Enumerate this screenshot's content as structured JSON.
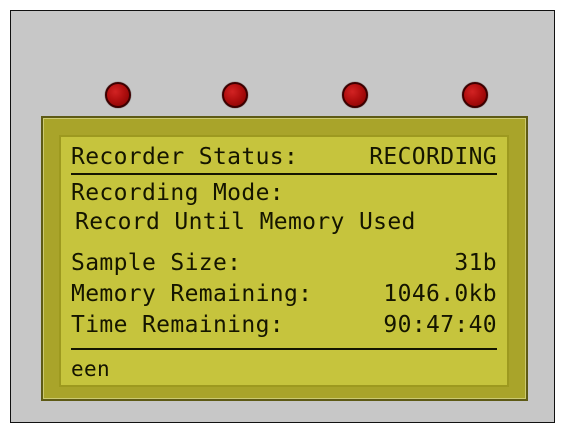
{
  "device": {
    "colors": {
      "panel": "#c7c7c7",
      "lcd": "#c6c43d",
      "lcd_border": "#a9a42a",
      "led": "#b10f0f",
      "text": "#151500"
    },
    "leds": [
      {
        "name": "led-1"
      },
      {
        "name": "led-2"
      },
      {
        "name": "led-3"
      },
      {
        "name": "led-4"
      }
    ]
  },
  "lcd": {
    "status_label": "Recorder Status:",
    "status_value": "RECORDING",
    "mode_label": "Recording Mode:",
    "mode_value": "Record Until Memory Used",
    "sample_label": "Sample Size:",
    "sample_value": "31b",
    "memory_label": "Memory Remaining:",
    "memory_value": "1046.0kb",
    "time_label": "Time Remaining:",
    "time_value": "90:47:40",
    "footer_text": "een"
  }
}
